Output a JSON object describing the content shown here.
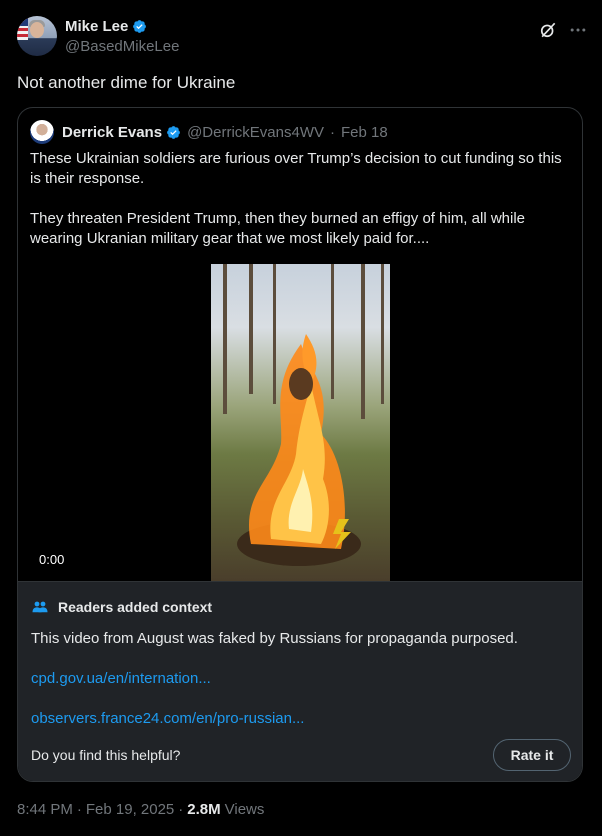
{
  "author": {
    "display_name": "Mike Lee",
    "handle": "@BasedMikeLee",
    "verified": true
  },
  "header_icons": [
    "grok-icon",
    "more-icon"
  ],
  "tweet_text": "Not another dime for Ukraine",
  "quoted": {
    "display_name": "Derrick Evans",
    "handle": "@DerrickEvans4WV",
    "separator": "·",
    "date": "Feb 18",
    "paragraphs": [
      "These Ukrainian soldiers are furious over Trump’s decision to cut funding so this is their response.",
      "They threaten President Trump, then they burned an effigy of him, all while wearing Ukranian military gear that we most likely paid for...."
    ],
    "video_time": "0:00"
  },
  "context": {
    "title": "Readers added context",
    "body": "This video from August was faked by Russians for propaganda purposed.",
    "link1": "cpd.gov.ua/en/internation...",
    "link2": "observers.france24.com/en/pro-russian...",
    "helpful_question": "Do you find this helpful?",
    "rate_label": "Rate it"
  },
  "meta": {
    "time": "8:44 PM",
    "sep1": "·",
    "date": "Feb 19, 2025",
    "sep2": "·",
    "views_count": "2.8M",
    "views_label": "Views"
  },
  "colors": {
    "background": "#000000",
    "text": "#e7e9ea",
    "secondary": "#71767b",
    "link": "#1d9bf0",
    "verified_badge": "#1d9bf0"
  }
}
